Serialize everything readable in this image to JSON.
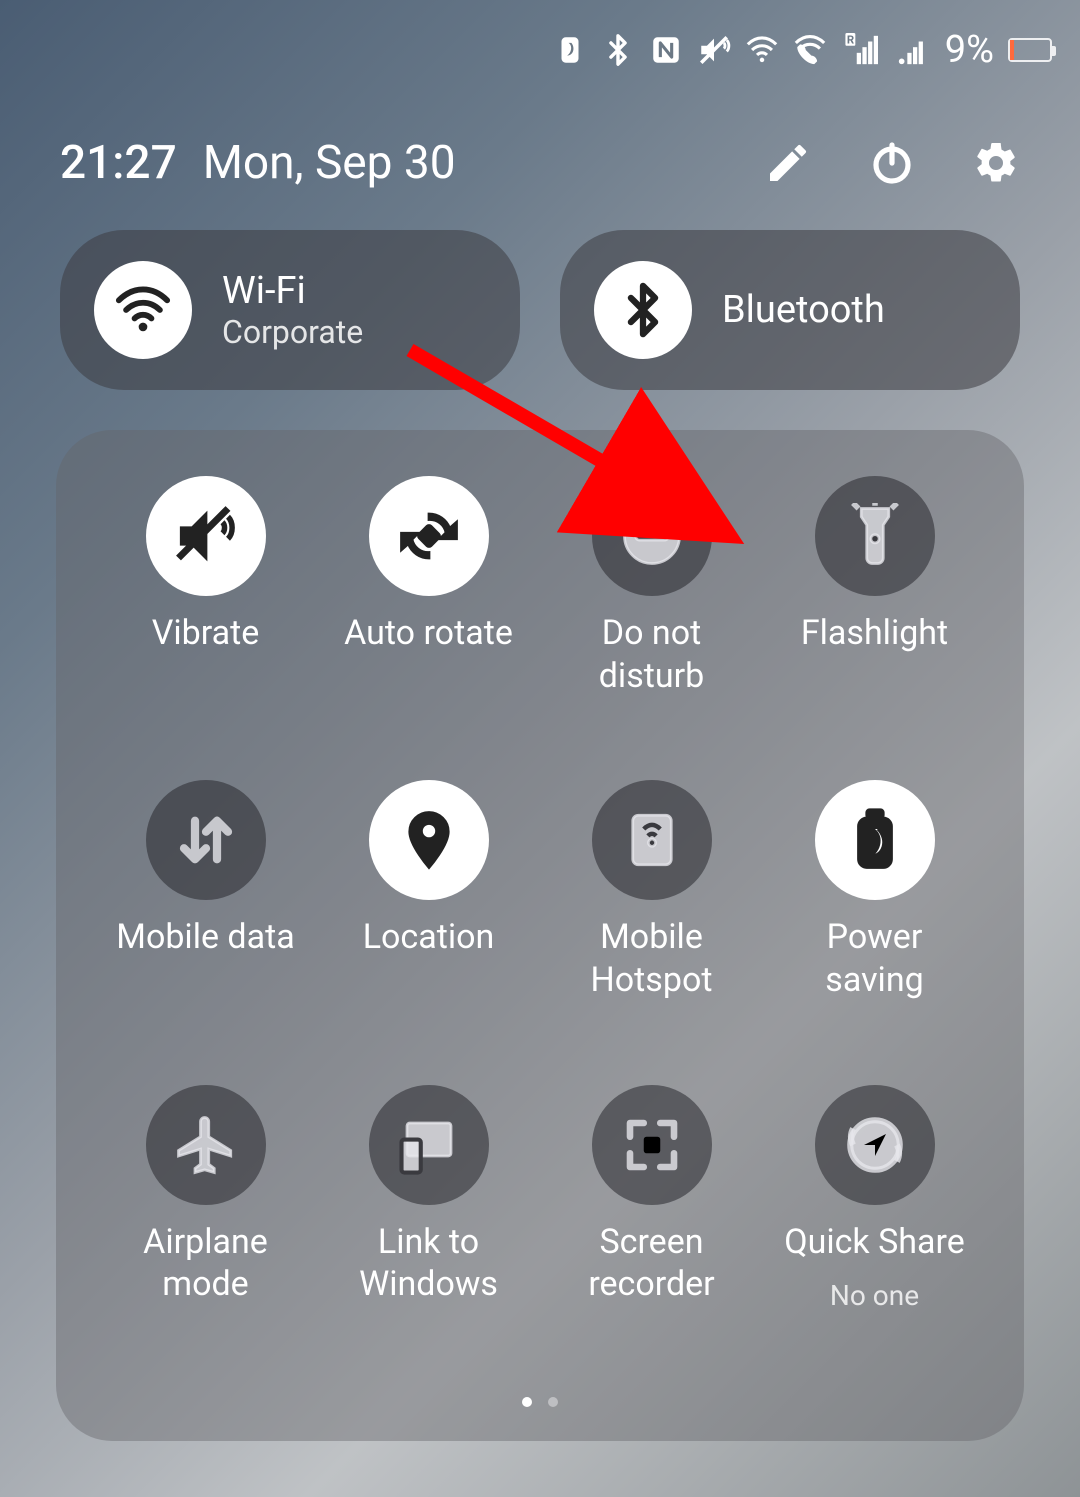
{
  "status": {
    "battery_percent": "9%"
  },
  "header": {
    "time": "21:27",
    "date": "Mon, Sep 30"
  },
  "connectivity": {
    "wifi": {
      "title": "Wi-Fi",
      "subtitle": "Corporate",
      "active": true
    },
    "bluetooth": {
      "title": "Bluetooth",
      "subtitle": "",
      "active": true
    }
  },
  "tiles": [
    {
      "id": "vibrate",
      "label": "Vibrate",
      "sub": "",
      "active": true
    },
    {
      "id": "autorotate",
      "label": "Auto rotate",
      "sub": "",
      "active": true
    },
    {
      "id": "dnd",
      "label": "Do not disturb",
      "sub": "",
      "active": false
    },
    {
      "id": "flashlight",
      "label": "Flashlight",
      "sub": "",
      "active": false
    },
    {
      "id": "mobiledata",
      "label": "Mobile data",
      "sub": "",
      "active": false
    },
    {
      "id": "location",
      "label": "Location",
      "sub": "",
      "active": true
    },
    {
      "id": "hotspot",
      "label": "Mobile Hotspot",
      "sub": "",
      "active": false
    },
    {
      "id": "powersaving",
      "label": "Power saving",
      "sub": "",
      "active": true
    },
    {
      "id": "airplane",
      "label": "Airplane mode",
      "sub": "",
      "active": false
    },
    {
      "id": "linktowindows",
      "label": "Link to Windows",
      "sub": "",
      "active": false
    },
    {
      "id": "screenrecorder",
      "label": "Screen recorder",
      "sub": "",
      "active": false
    },
    {
      "id": "quickshare",
      "label": "Quick Share",
      "sub": "No one",
      "active": false
    }
  ],
  "annotation": {
    "arrow_points_to": "flashlight"
  }
}
